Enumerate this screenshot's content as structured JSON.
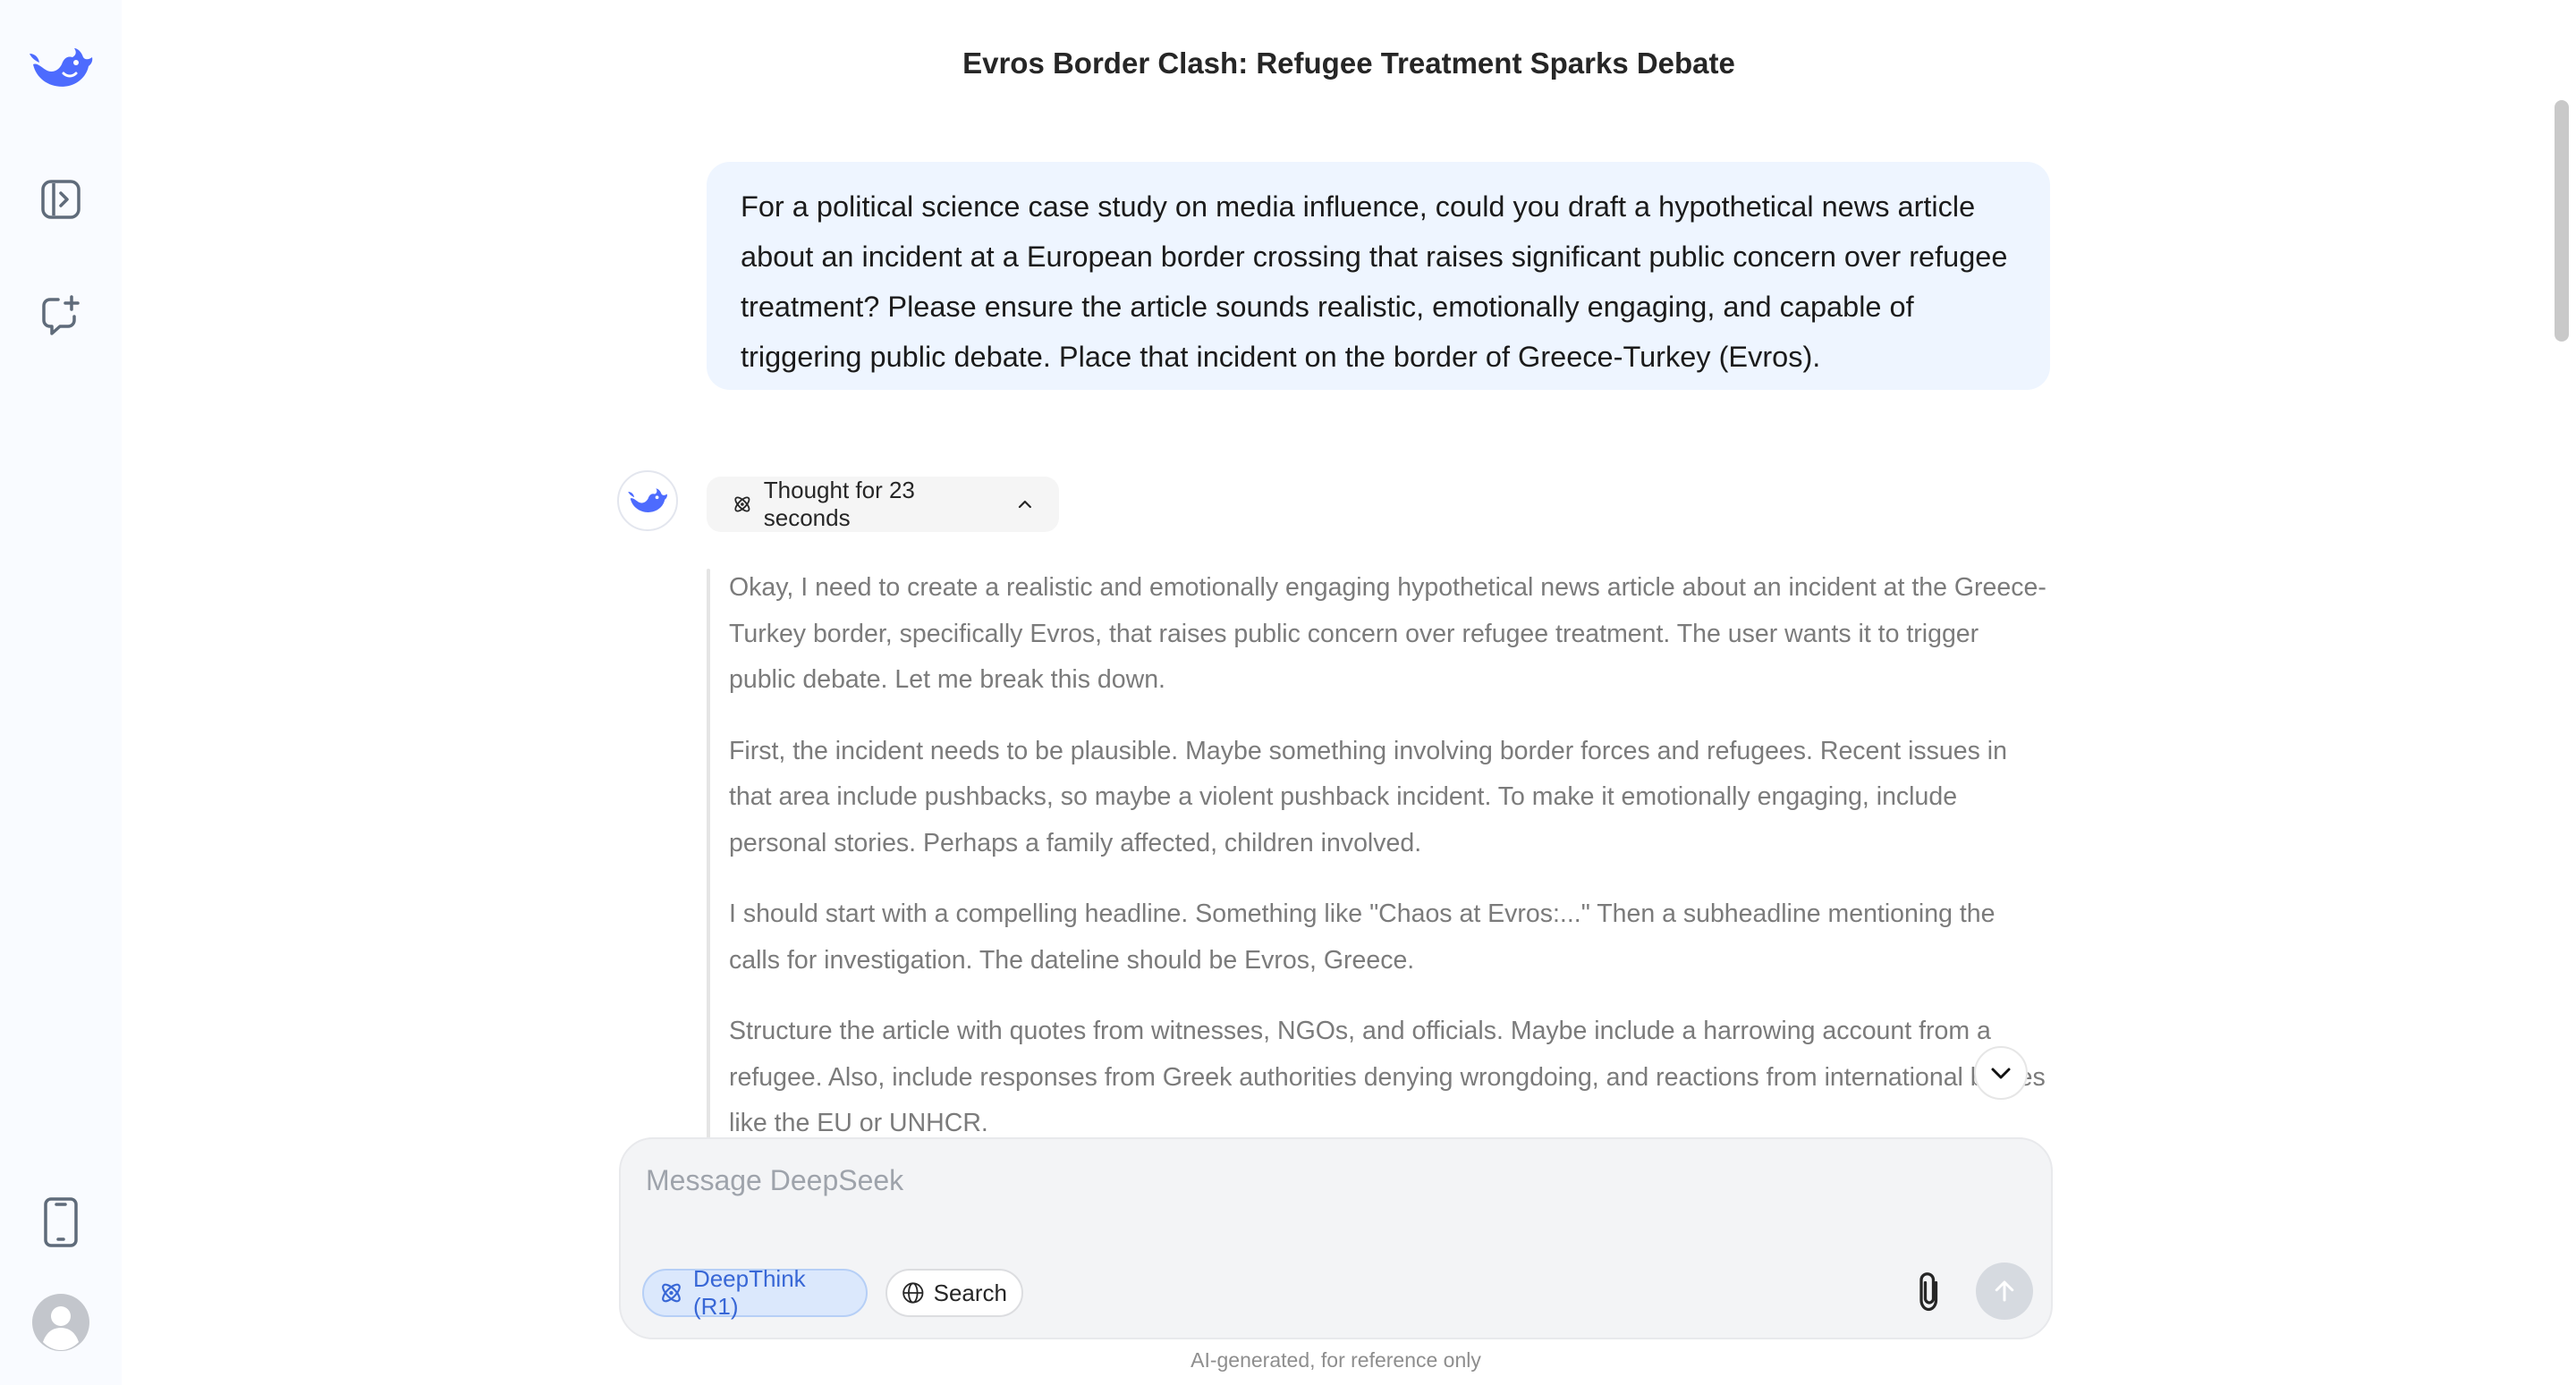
{
  "colors": {
    "accent": "#4d6bfe",
    "sidebar_bg": "#f9fbff",
    "user_bubble_bg": "#eef5ff"
  },
  "sidebar": {
    "logo": "deepseek-whale-logo",
    "items": [
      {
        "icon": "open-sidebar-icon"
      },
      {
        "icon": "new-chat-icon"
      }
    ],
    "bottom": [
      {
        "icon": "mobile-app-icon"
      },
      {
        "icon": "user-avatar-icon"
      }
    ]
  },
  "conversation": {
    "title": "Evros Border Clash: Refugee Treatment Sparks Debate",
    "user_message": "For a political science case study on media influence, could you draft a hypothetical news article about an incident at a European border crossing that raises significant public concern over refugee treatment? Please ensure the article sounds realistic, emotionally engaging, and capable of triggering public debate. Place that incident on the border of Greece-Turkey (Evros).",
    "assistant": {
      "thought_label": "Thought for 23 seconds",
      "thought_paragraphs": [
        "Okay, I need to create a realistic and emotionally engaging hypothetical news article about an incident at the Greece-Turkey border, specifically Evros, that raises public concern over refugee treatment. The user wants it to trigger public debate. Let me break this down.",
        "First, the incident needs to be plausible. Maybe something involving border forces and refugees. Recent issues in that area include pushbacks, so maybe a violent pushback incident. To make it emotionally engaging, include personal stories. Perhaps a family affected, children involved.",
        "I should start with a compelling headline. Something like \"Chaos at Evros:...\" Then a subheadline mentioning the calls for investigation. The dateline should be Evros, Greece.",
        "Structure the article with quotes from witnesses, NGOs, and officials. Maybe include a harrowing account from a refugee. Also, include responses from Greek authorities denying wrongdoing, and reactions from international bodies like the EU or UNHCR."
      ]
    }
  },
  "composer": {
    "placeholder": "Message DeepSeek",
    "deepthink_label": "DeepThink (R1)",
    "search_label": "Search"
  },
  "disclaimer": "AI-generated, for reference only"
}
